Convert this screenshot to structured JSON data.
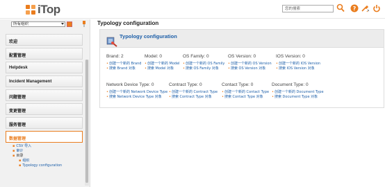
{
  "header": {
    "logo_text": "iTop",
    "search_placeholder": "您的搜索",
    "icons": [
      "search-icon",
      "help-icon",
      "tools-icon",
      "power-icon"
    ],
    "accent": "#ea7d1e"
  },
  "sidebar": {
    "org_select": "所有组织",
    "menu": [
      "欢迎",
      "配置管理",
      "Helpdesk",
      "Incident Management",
      "问题管理",
      "变更管理",
      "服务管理",
      "数据管理"
    ],
    "active_item": "数据管理",
    "submenu": {
      "csv_import": "CSV 导入",
      "audit": "审计",
      "catalog": "目录",
      "org": "组织",
      "typology": "Typology configuration"
    }
  },
  "main": {
    "page_title": "Typology configuration",
    "panel_title": "Typology configuration",
    "row1": [
      {
        "label": "Brand: 2",
        "create": "创建一个新的 Brand",
        "search": "搜索 Brand 对象"
      },
      {
        "label": "Model: 0",
        "create": "创建一个新的 Model",
        "search": "搜索 Model 对象"
      },
      {
        "label": "OS Family: 0",
        "create": "创建一个新的 OS Family",
        "search": "搜索 OS Family 对象"
      },
      {
        "label": "OS Version: 0",
        "create": "创建一个新的 OS Version",
        "search": "搜索 OS Version 对象"
      },
      {
        "label": "IOS Version: 0",
        "create": "创建一个新的 IOS Version",
        "search": "搜索 IOS Version 对象"
      }
    ],
    "row2": [
      {
        "label": "Network Device Type: 0",
        "create": "创建一个新的 Network Device Type",
        "search": "搜索 Network Device Type 对象"
      },
      {
        "label": "Contract Type: 0",
        "create": "创建一个新的 Contract Type",
        "search": "搜索 Contract Type 对象"
      },
      {
        "label": "Contact Type: 0",
        "create": "创建一个新的 Contact Type",
        "search": "搜索 Contact Type 对象"
      },
      {
        "label": "Document Type: 0",
        "create": "创建一个新的 Document Type",
        "search": "搜索 Document Type 对象"
      }
    ]
  }
}
